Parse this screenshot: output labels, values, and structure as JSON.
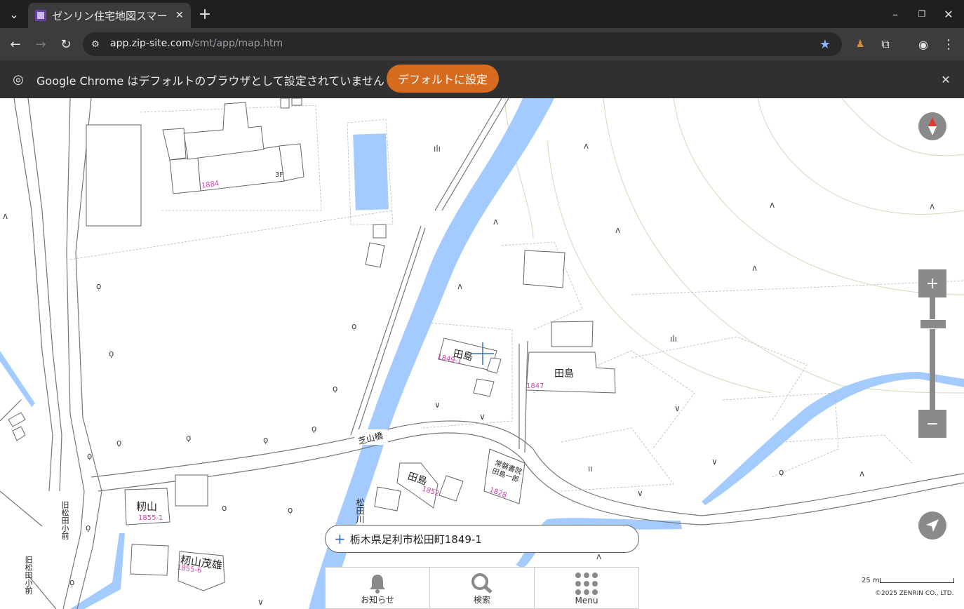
{
  "browser": {
    "tab_title": "ゼンリン住宅地図スマー",
    "url_host": "app.zip-site.com",
    "url_path": "/smt/app/map.htm"
  },
  "infobar": {
    "message": "Google Chrome はデフォルトのブラウザとして設定されていません",
    "button_label": "デフォルトに設定"
  },
  "map": {
    "labels": {
      "tajima1": "田島",
      "tajima2": "田島",
      "tajima3": "田島",
      "momiyama": "籾山",
      "momiyama_shigeo": "籾山茂雄",
      "bridge": "芝山橋",
      "river": "松田川",
      "shop": "常磐書院 田島一郎",
      "bus1": "旧松田小前",
      "bus2": "旧松田小前"
    },
    "numbers": {
      "n1884": "1884",
      "n3f": "3F",
      "n1849": "1849-1",
      "n1847": "1847",
      "n1852": "1852",
      "n1828": "1828",
      "n1855_1": "1855-1",
      "n1855_6": "1855-6"
    }
  },
  "controls": {
    "zoom_in": "+",
    "zoom_out": "−"
  },
  "address": "栃木県足利市松田町1849-1",
  "bottom_nav": {
    "notice": "お知らせ",
    "search": "検索",
    "menu": "Menu"
  },
  "scale_label": "25 m",
  "copyright": "©2025 ZENRIN CO., LTD."
}
